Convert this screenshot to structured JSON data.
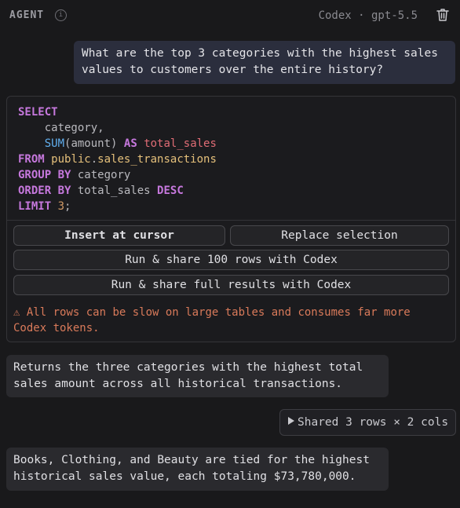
{
  "header": {
    "agent_label": "AGENT",
    "info_glyph": "i",
    "model_label": "Codex · gpt-5.5",
    "info_icon": "info-icon",
    "trash_icon": "trash-icon"
  },
  "chat": {
    "user_message": "What are the top 3 categories with the highest sales values to customers over the entire history?",
    "sql": {
      "kw_select": "SELECT",
      "col_category": "category,",
      "fn_sum": "SUM",
      "sum_arg": "(amount)",
      "kw_as": "AS",
      "alias": "total_sales",
      "kw_from": "FROM",
      "schema": "public",
      "dot": ".",
      "table": "sales_transactions",
      "kw_group_by": "GROUP BY",
      "group_col": "category",
      "kw_order_by": "ORDER BY",
      "order_col": "total_sales",
      "kw_desc": "DESC",
      "kw_limit": "LIMIT",
      "limit_value": "3",
      "semicolon": ";"
    },
    "actions": {
      "insert_label": "Insert at cursor",
      "replace_label": "Replace selection",
      "run100_label": "Run & share 100 rows with Codex",
      "runfull_label": "Run & share full results with Codex"
    },
    "warning": {
      "icon": "warning-icon",
      "glyph": "⚠",
      "text": "All rows can be slow on large tables and consumes far more Codex tokens."
    },
    "assistant_message_1": "Returns the three categories with the highest total sales amount across all historical transactions.",
    "shared_result": {
      "icon": "play-icon",
      "label": "Shared 3 rows × 2 cols"
    },
    "assistant_message_2": "Books, Clothing, and Beauty are tied for the highest historical sales value, each totaling $73,780,000."
  },
  "colors": {
    "background": "#19191b",
    "user_bubble": "#2b2e3d",
    "assistant_bubble": "#2a2a2e",
    "sql_keyword": "#c678dd",
    "sql_function": "#61afef",
    "sql_alias": "#e06c75",
    "sql_table": "#e5c07b",
    "sql_number": "#d19a66",
    "warning": "#d97a5a"
  }
}
